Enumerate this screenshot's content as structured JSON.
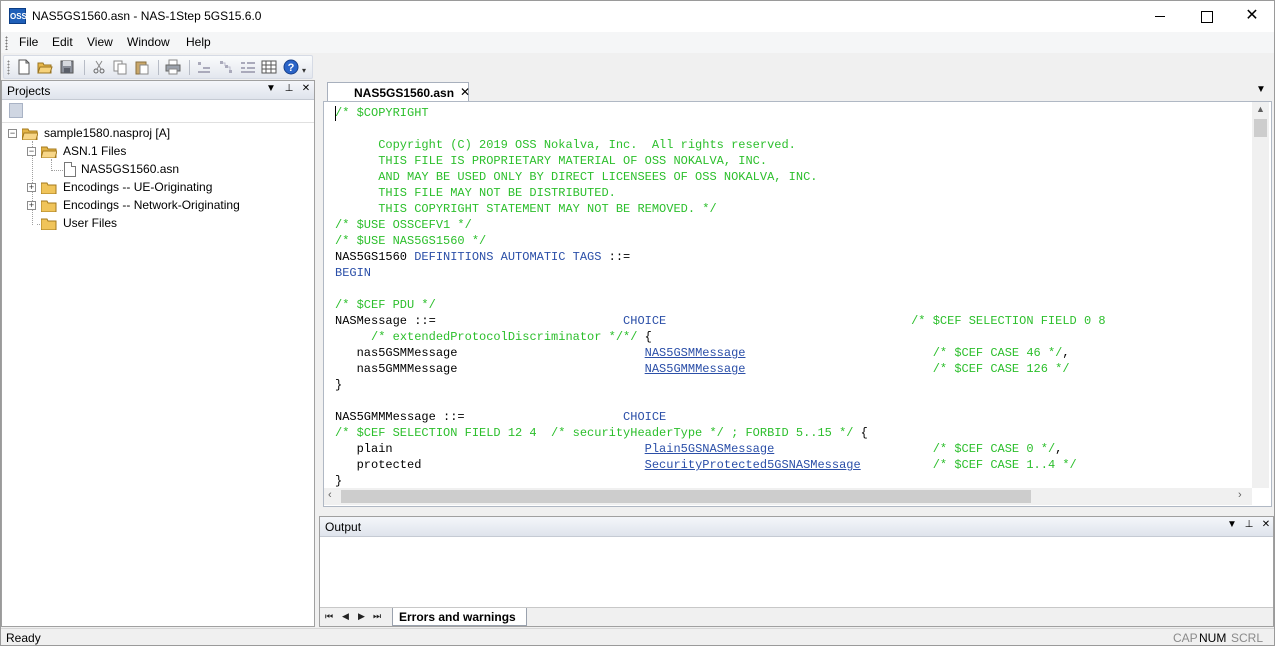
{
  "window": {
    "title": "NAS5GS1560.asn - NAS-1Step 5GS15.6.0",
    "logo_text": "OSS",
    "minimize_icon": "minimize-icon",
    "maximize_icon": "maximize-icon",
    "close_glyph": "✕"
  },
  "menu": {
    "items": [
      "File",
      "Edit",
      "View",
      "Window",
      "Help"
    ]
  },
  "toolbar": {
    "icons": [
      "new-file-icon",
      "open-folder-icon",
      "save-icon",
      "cut-icon",
      "copy-icon",
      "paste-icon",
      "print-icon",
      "compile-icon",
      "encode-icon",
      "decode-icon",
      "table-icon",
      "help-icon"
    ],
    "overflow_glyph": "▾"
  },
  "projects_panel": {
    "title": "Projects",
    "dropdown_glyph": "▼",
    "pin_glyph": "⊥",
    "close_glyph": "✕",
    "tree": {
      "root": {
        "label": "sample1580.nasproj [A]",
        "expander": "−"
      },
      "asn_files": {
        "label": "ASN.1 Files",
        "expander": "−"
      },
      "asn_file": {
        "label": "NAS5GS1560.asn"
      },
      "enc_ue": {
        "label": "Encodings -- UE-Originating",
        "expander": "+"
      },
      "enc_net": {
        "label": "Encodings -- Network-Originating",
        "expander": "+"
      },
      "user_files": {
        "label": "User Files"
      }
    }
  },
  "editor": {
    "tab_label": "NAS5GS1560.asn",
    "tab_close": "✕",
    "tab_dropdown": "▼",
    "scroll_up": "▲",
    "scroll_left": "‹",
    "scroll_right": "›",
    "lines": [
      [
        {
          "t": "/* $COPYRIGHT",
          "c": "comment"
        }
      ],
      [
        {
          "t": "",
          "c": "plain"
        }
      ],
      [
        {
          "t": "      Copyright (C) 2019 OSS Nokalva, Inc.  All rights reserved.",
          "c": "comment"
        }
      ],
      [
        {
          "t": "      THIS FILE IS PROPRIETARY MATERIAL OF OSS NOKALVA, INC.",
          "c": "comment"
        }
      ],
      [
        {
          "t": "      AND MAY BE USED ONLY BY DIRECT LICENSEES OF OSS NOKALVA, INC.",
          "c": "comment"
        }
      ],
      [
        {
          "t": "      THIS FILE MAY NOT BE DISTRIBUTED.",
          "c": "comment"
        }
      ],
      [
        {
          "t": "      THIS COPYRIGHT STATEMENT MAY NOT BE REMOVED. */",
          "c": "comment"
        }
      ],
      [
        {
          "t": "/* $USE OSSCEFV1 */",
          "c": "comment"
        }
      ],
      [
        {
          "t": "/* $USE NAS5GS1560 */",
          "c": "comment"
        }
      ],
      [
        {
          "t": "NAS5GS1560 ",
          "c": "plain"
        },
        {
          "t": "DEFINITIONS AUTOMATIC TAGS",
          "c": "kw"
        },
        {
          "t": " ::=",
          "c": "plain"
        }
      ],
      [
        {
          "t": "BEGIN",
          "c": "kw"
        }
      ],
      [
        {
          "t": "",
          "c": "plain"
        }
      ],
      [
        {
          "t": "/* $CEF PDU */",
          "c": "comment"
        }
      ],
      [
        {
          "t": "NASMessage ::=                          ",
          "c": "plain"
        },
        {
          "t": "CHOICE",
          "c": "kw"
        },
        {
          "t": "                                  ",
          "c": "plain"
        },
        {
          "t": "/* $CEF SELECTION FIELD 0 8",
          "c": "comment"
        }
      ],
      [
        {
          "t": "     ",
          "c": "plain"
        },
        {
          "t": "/* extendedProtocolDiscriminator */*/",
          "c": "comment"
        },
        {
          "t": " {",
          "c": "plain"
        }
      ],
      [
        {
          "t": "   nas5GSMMessage                          ",
          "c": "plain"
        },
        {
          "t": "NAS5GSMMessage",
          "c": "link"
        },
        {
          "t": "                          ",
          "c": "plain"
        },
        {
          "t": "/* $CEF CASE 46 */",
          "c": "comment"
        },
        {
          "t": ",",
          "c": "plain"
        }
      ],
      [
        {
          "t": "   nas5GMMMessage                          ",
          "c": "plain"
        },
        {
          "t": "NAS5GMMMessage",
          "c": "link"
        },
        {
          "t": "                          ",
          "c": "plain"
        },
        {
          "t": "/* $CEF CASE 126 */",
          "c": "comment"
        }
      ],
      [
        {
          "t": "}",
          "c": "plain"
        }
      ],
      [
        {
          "t": "",
          "c": "plain"
        }
      ],
      [
        {
          "t": "NAS5GMMMessage ::=                      ",
          "c": "plain"
        },
        {
          "t": "CHOICE",
          "c": "kw"
        }
      ],
      [
        {
          "t": "/* $CEF SELECTION FIELD 12 4  /* securityHeaderType */ ; FORBID 5..15 */",
          "c": "comment"
        },
        {
          "t": " {",
          "c": "plain"
        }
      ],
      [
        {
          "t": "   plain                                   ",
          "c": "plain"
        },
        {
          "t": "Plain5GSNASMessage",
          "c": "link"
        },
        {
          "t": "                      ",
          "c": "plain"
        },
        {
          "t": "/* $CEF CASE 0 */",
          "c": "comment"
        },
        {
          "t": ",",
          "c": "plain"
        }
      ],
      [
        {
          "t": "   protected                               ",
          "c": "plain"
        },
        {
          "t": "SecurityProtected5GSNASMessage",
          "c": "link"
        },
        {
          "t": "          ",
          "c": "plain"
        },
        {
          "t": "/* $CEF CASE 1..4 */",
          "c": "comment"
        }
      ],
      [
        {
          "t": "}",
          "c": "plain"
        }
      ]
    ]
  },
  "output_panel": {
    "title": "Output",
    "dropdown_glyph": "▼",
    "pin_glyph": "⊥",
    "close_glyph": "✕",
    "nav": [
      "⏮",
      "◀",
      "▶",
      "⏭"
    ],
    "tab_label": "Errors and warnings"
  },
  "statusbar": {
    "text": "Ready",
    "indicators": [
      {
        "label": "CAP",
        "active": false
      },
      {
        "label": "NUM",
        "active": true
      },
      {
        "label": "SCRL",
        "active": false
      }
    ]
  }
}
